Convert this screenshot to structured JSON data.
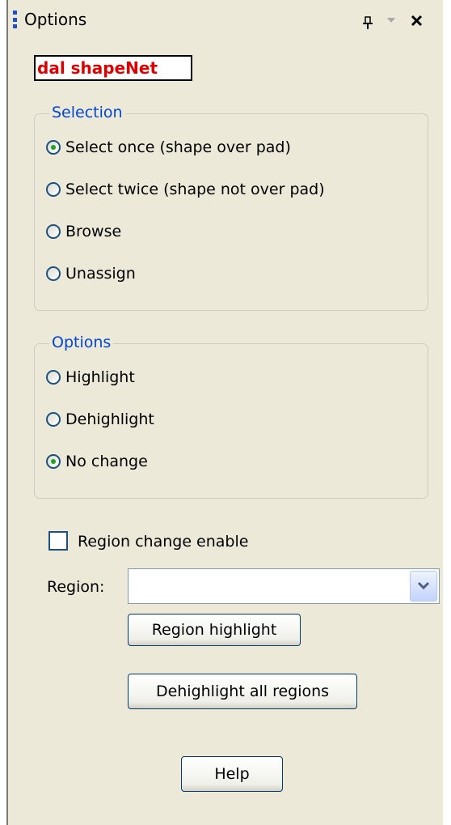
{
  "window": {
    "title": "Options",
    "pin_icon": "pin-icon",
    "dropdown_icon": "chevron-down-icon",
    "close_icon": "close-icon"
  },
  "banner": {
    "text": "dal shapeNet",
    "color": "#e00000"
  },
  "selection_group": {
    "legend": "Selection",
    "options": [
      {
        "label": "Select once (shape over pad)",
        "checked": true
      },
      {
        "label": "Select twice (shape not over pad)",
        "checked": false
      },
      {
        "label": "Browse",
        "checked": false
      },
      {
        "label": "Unassign",
        "checked": false
      }
    ]
  },
  "options_group": {
    "legend": "Options",
    "options": [
      {
        "label": "Highlight",
        "checked": false
      },
      {
        "label": "Dehighlight",
        "checked": false
      },
      {
        "label": "No change",
        "checked": true
      }
    ]
  },
  "region_change": {
    "label": "Region change enable",
    "checked": false
  },
  "region": {
    "label": "Region:",
    "value": ""
  },
  "buttons": {
    "region_highlight": "Region highlight",
    "dehighlight_all": "Dehighlight all regions",
    "help": "Help"
  },
  "colors": {
    "panel_bg": "#ece9d8",
    "legend_blue": "#0046d5",
    "radio_check_green": "#21a121"
  }
}
